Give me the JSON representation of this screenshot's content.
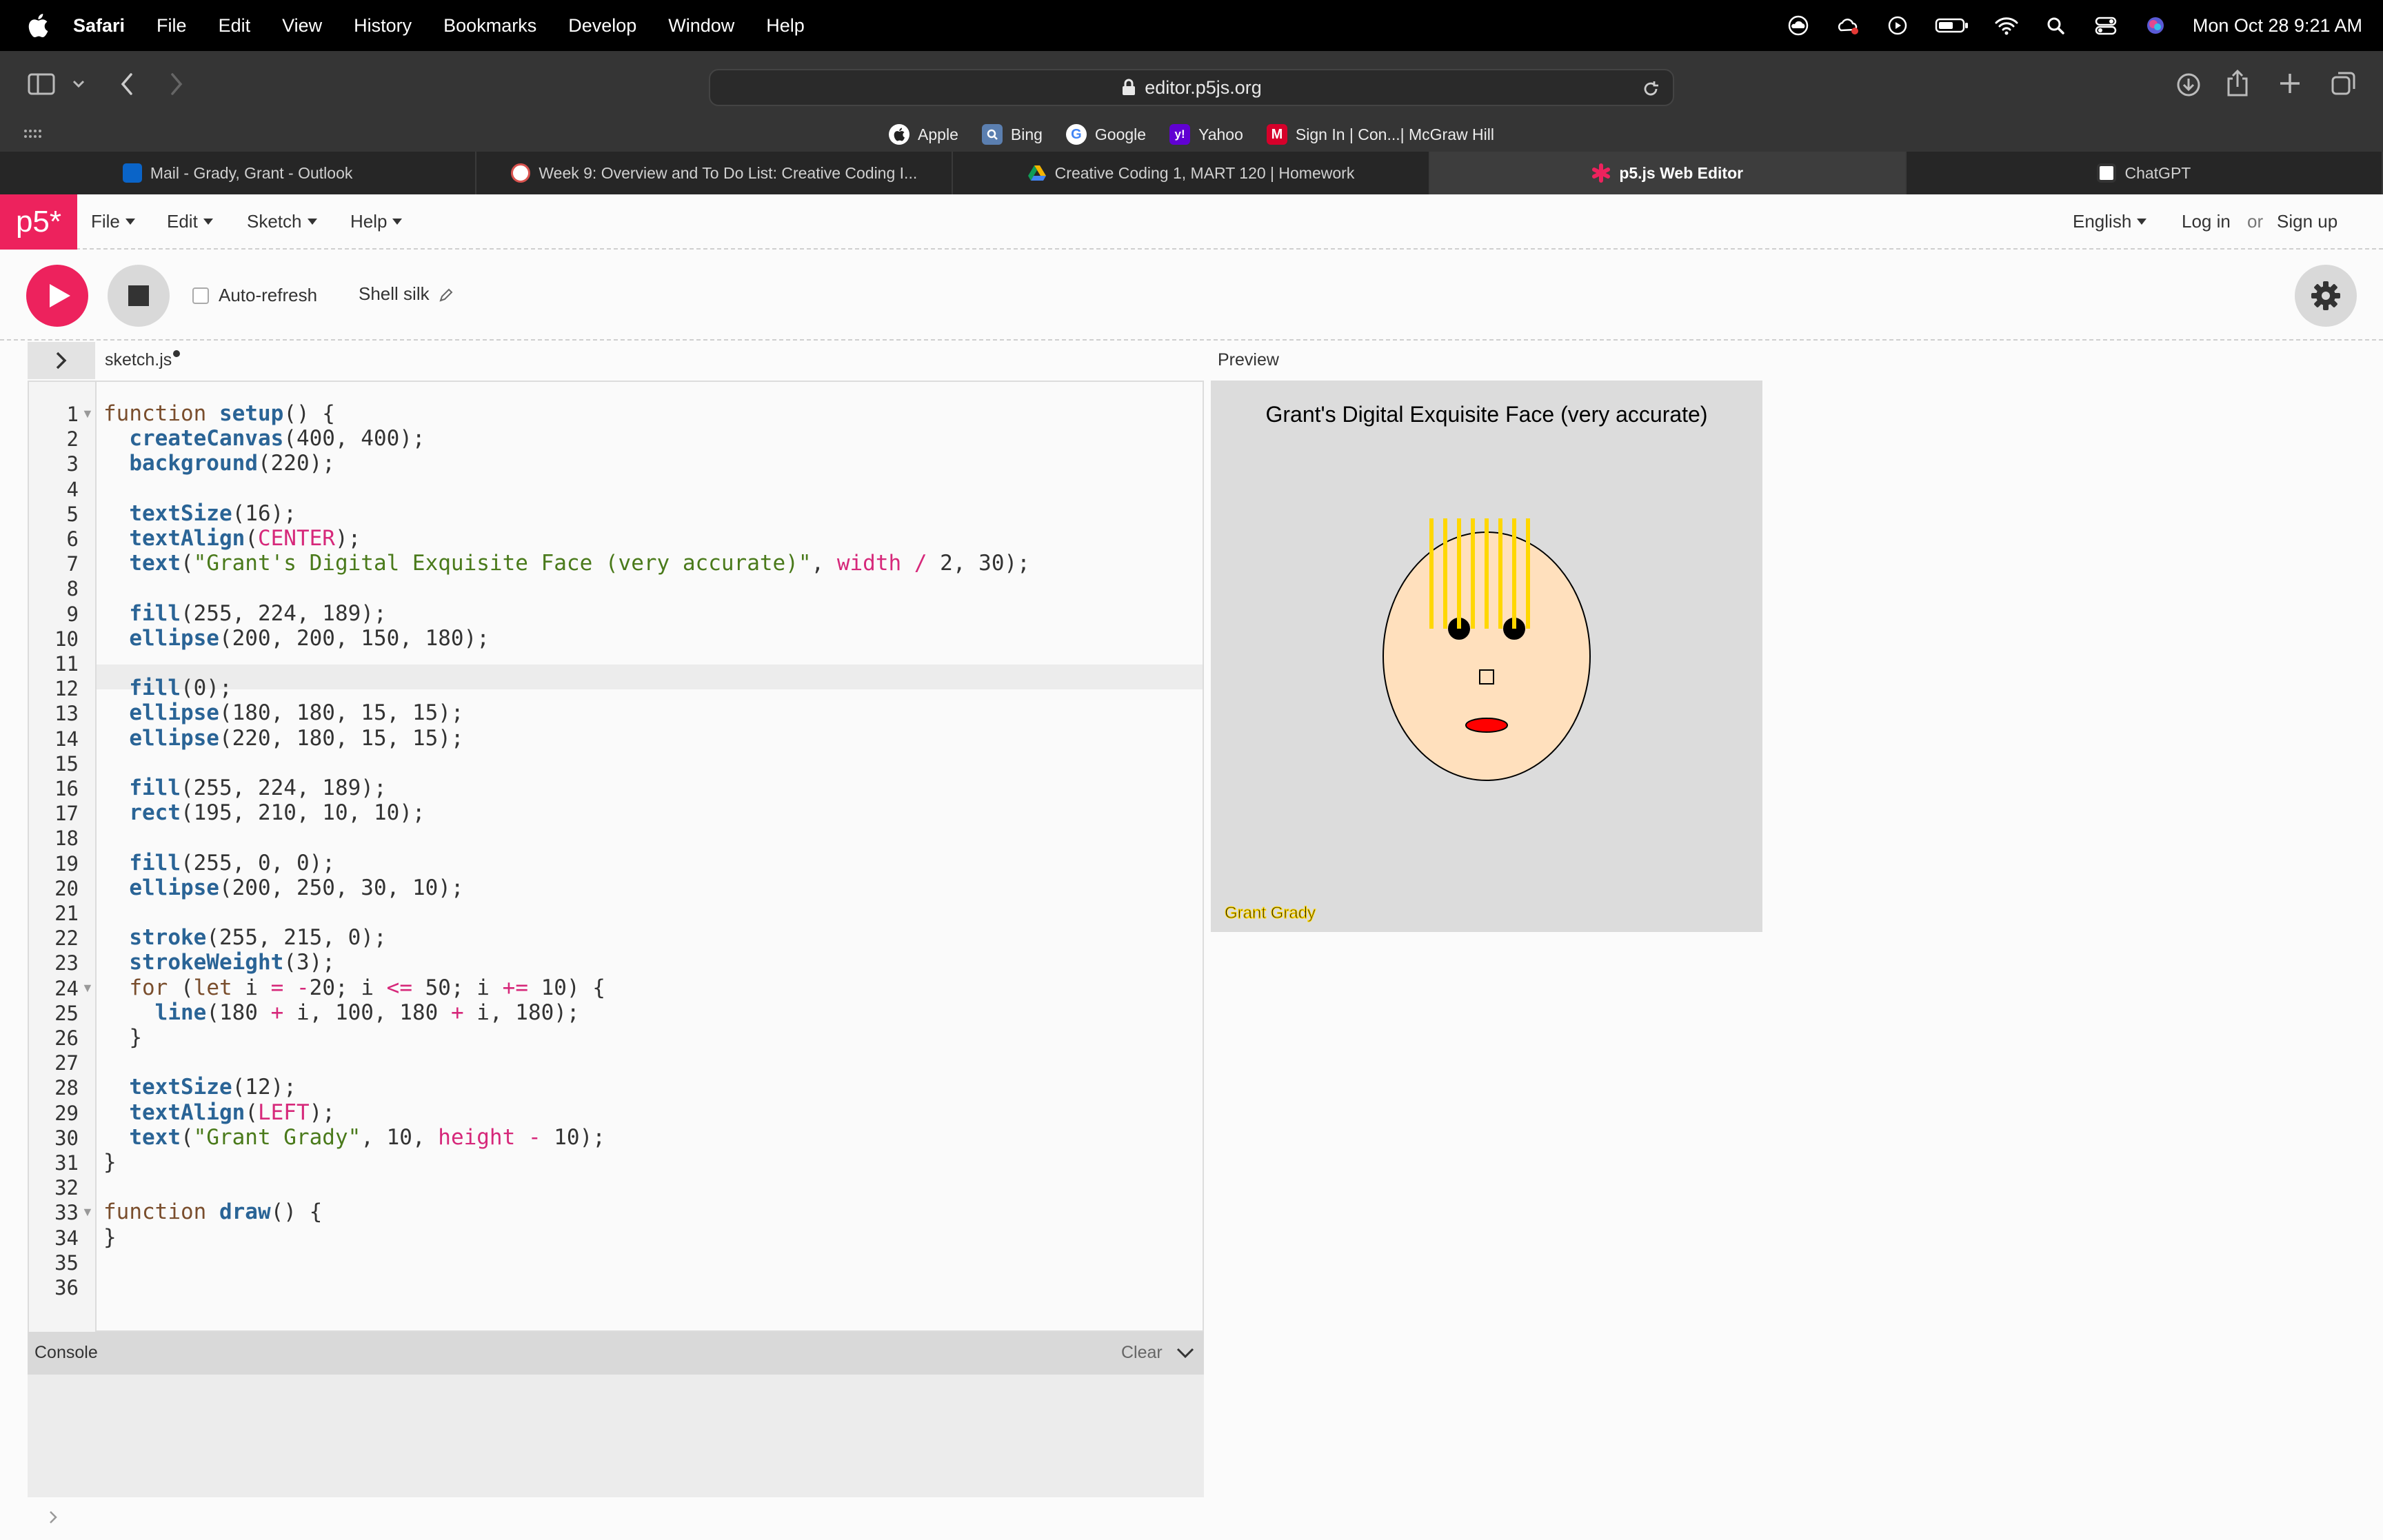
{
  "menubar": {
    "app_name": "Safari",
    "items": [
      "File",
      "Edit",
      "View",
      "History",
      "Bookmarks",
      "Develop",
      "Window",
      "Help"
    ],
    "clock": "Mon Oct 28  9:21 AM"
  },
  "browser": {
    "url": "editor.p5js.org",
    "favorites": [
      {
        "label": "Apple",
        "icon": "apple-icon",
        "color": "#ffffff"
      },
      {
        "label": "Bing",
        "icon": "bing-icon",
        "color": "#5b7fb0"
      },
      {
        "label": "Google",
        "icon": "google-icon",
        "color": "#ffffff"
      },
      {
        "label": "Yahoo",
        "icon": "yahoo-icon",
        "color": "#6001d2"
      },
      {
        "label": "Sign In | Con...| McGraw Hill",
        "icon": "mcgraw-hill-icon",
        "color": "#d6002a"
      }
    ],
    "tabs": [
      {
        "label": "Mail - Grady, Grant - Outlook",
        "icon_color": "#0a64c8",
        "active": false
      },
      {
        "label": "Week 9: Overview and To Do List: Creative Coding I...",
        "icon_color": "#d9534f",
        "active": false
      },
      {
        "label": "Creative Coding 1, MART 120 | Homework",
        "icon_color": "#f4b400",
        "active": false
      },
      {
        "label": "p5.js Web Editor",
        "icon_color": "#ed225d",
        "active": true
      },
      {
        "label": "ChatGPT",
        "icon_color": "#ffffff",
        "active": false
      }
    ]
  },
  "p5nav": {
    "logo": "p5*",
    "menus": [
      "File",
      "Edit",
      "Sketch",
      "Help"
    ],
    "language": "English",
    "login": "Log in",
    "or": "or",
    "signup": "Sign up"
  },
  "toolbar": {
    "auto_refresh_label": "Auto-refresh",
    "sketch_name": "Shell silk"
  },
  "editor": {
    "filename": "sketch.js",
    "line_numbers": [
      "1",
      "2",
      "3",
      "4",
      "5",
      "6",
      "7",
      "8",
      "9",
      "10",
      "11",
      "12",
      "13",
      "14",
      "15",
      "16",
      "17",
      "18",
      "19",
      "20",
      "21",
      "22",
      "23",
      "24",
      "25",
      "26",
      "27",
      "28",
      "29",
      "30",
      "31",
      "32",
      "33",
      "34",
      "35",
      "36"
    ],
    "code": [
      "function setup() {",
      "  createCanvas(400, 400);",
      "  background(220);",
      "",
      "  textSize(16);",
      "  textAlign(CENTER);",
      "  text(\"Grant's Digital Exquisite Face (very accurate)\", width / 2, 30);",
      "",
      "  fill(255, 224, 189);",
      "  ellipse(200, 200, 150, 180);",
      "",
      "  fill(0);",
      "  ellipse(180, 180, 15, 15);",
      "  ellipse(220, 180, 15, 15);",
      "",
      "  fill(255, 224, 189);",
      "  rect(195, 210, 10, 10);",
      "",
      "  fill(255, 0, 0);",
      "  ellipse(200, 250, 30, 10);",
      "",
      "  stroke(255, 215, 0);",
      "  strokeWeight(3);",
      "  for (let i = -20; i <= 50; i += 10) {",
      "    line(180 + i, 100, 180 + i, 180);",
      "  }",
      "",
      "  textSize(12);",
      "  textAlign(LEFT);",
      "  text(\"Grant Grady\", 10, height - 10);",
      "}",
      "",
      "function draw() {",
      "}",
      "",
      ""
    ]
  },
  "console": {
    "title": "Console",
    "clear_label": "Clear"
  },
  "preview": {
    "label": "Preview",
    "canvas_title": "Grant's Digital Exquisite Face (very accurate)",
    "canvas_signature": "Grant Grady"
  }
}
